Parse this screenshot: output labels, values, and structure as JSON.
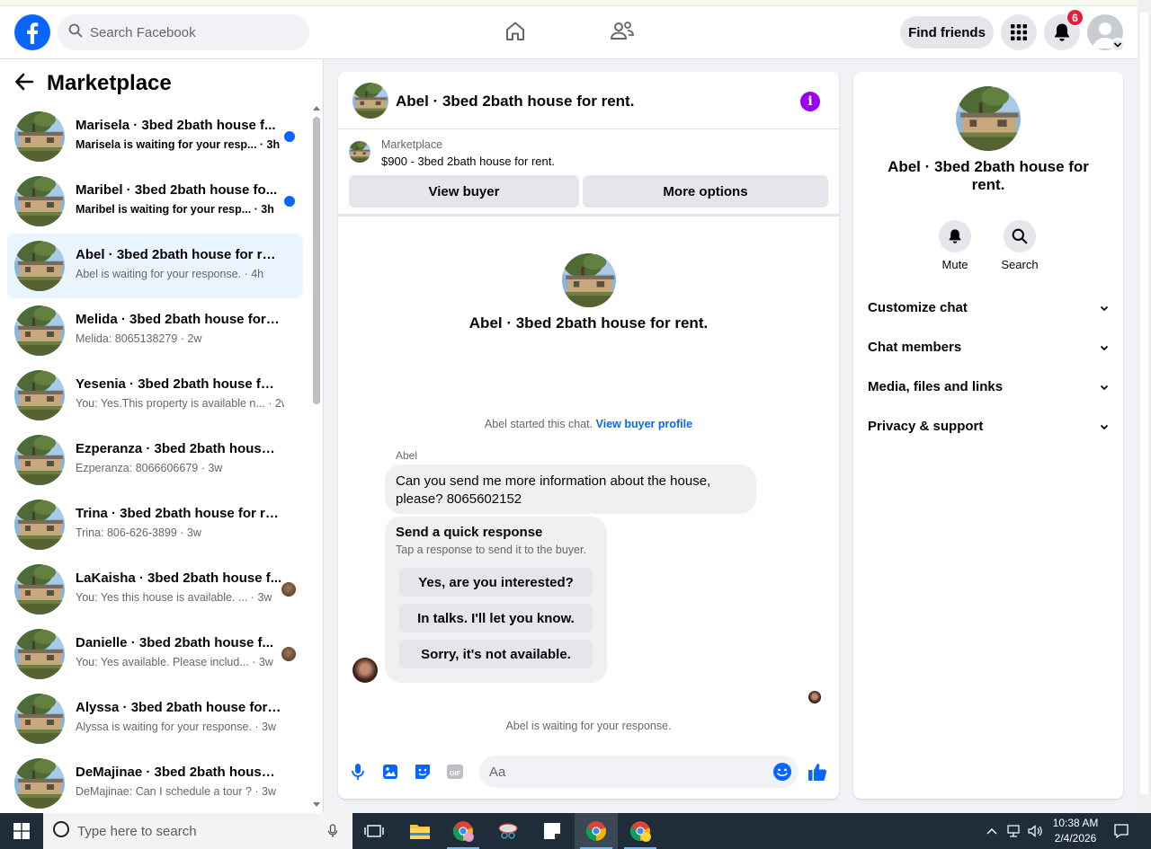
{
  "header": {
    "search_placeholder": "Search Facebook",
    "find_friends_label": "Find friends",
    "notification_count": "6"
  },
  "sidebar": {
    "title": "Marketplace",
    "conversations": [
      {
        "name": "Marisela · 3bed 2bath house f...",
        "preview": "Marisela is waiting for your resp... · 3h",
        "unread": true
      },
      {
        "name": "Maribel · 3bed 2bath house fo...",
        "preview": "Maribel is waiting for your resp... · 3h",
        "unread": true
      },
      {
        "name": "Abel · 3bed 2bath house for rent.",
        "preview": "Abel is waiting for your response. · 4h",
        "unread": false,
        "active": true
      },
      {
        "name": "Melida · 3bed 2bath house for r...",
        "preview": "Melida: 8065138279 · 2w",
        "unread": false
      },
      {
        "name": "Yesenia · 3bed 2bath house for r...",
        "preview": "You: Yes.This property is available n... · 2w",
        "unread": false
      },
      {
        "name": "Ezperanza · 3bed 2bath house f...",
        "preview": "Ezperanza: 8066606679 · 3w",
        "unread": false
      },
      {
        "name": "Trina · 3bed 2bath house for rent.",
        "preview": "Trina: 806-626-3899 · 3w",
        "unread": false
      },
      {
        "name": "LaKaisha · 3bed 2bath house f...",
        "preview": "You: Yes this house is available. ... · 3w",
        "unread": false
      },
      {
        "name": "Danielle · 3bed 2bath house f...",
        "preview": "You: Yes available. Please includ... · 3w",
        "unread": false
      },
      {
        "name": "Alyssa · 3bed 2bath house for re...",
        "preview": "Alyssa is waiting for your response. · 3w",
        "unread": false
      },
      {
        "name": "DeMajinae · 3bed 2bath house f...",
        "preview": "DeMajinae: Can I schedule a tour ? · 3w",
        "unread": false
      }
    ]
  },
  "chat": {
    "title": "Abel · 3bed 2bath house for rent.",
    "marketplace_label": "Marketplace",
    "listing": "$900 - 3bed 2bath house for rent.",
    "view_buyer_label": "View buyer",
    "more_options_label": "More options",
    "intro_title": "Abel · 3bed 2bath house for rent.",
    "started_text": "Abel started this chat.",
    "view_profile_link": "View buyer profile",
    "sender_name": "Abel",
    "message_line1": "Can you send me more information about the house,",
    "message_line2": "please? 8065602152",
    "quick_title": "Send a quick response",
    "quick_subtitle": "Tap a response to send it to the buyer.",
    "quick_replies": [
      "Yes, are you interested?",
      "In talks. I'll let you know.",
      "Sorry, it's not available."
    ],
    "waiting_text": "Abel is waiting for your response.",
    "input_placeholder": "Aa"
  },
  "details": {
    "title": "Abel · 3bed 2bath house for rent.",
    "mute_label": "Mute",
    "search_label": "Search",
    "sections": [
      "Customize chat",
      "Chat members",
      "Media, files and links",
      "Privacy & support"
    ]
  },
  "taskbar": {
    "search_placeholder": "Type here to search",
    "time": "10:38 AM",
    "date": "2/4/2026"
  },
  "colors": {
    "facebook_blue": "#0866ff",
    "info_purple": "#9900ef",
    "badge_red": "#e41e3f",
    "active_row": "#ebf5ff"
  }
}
